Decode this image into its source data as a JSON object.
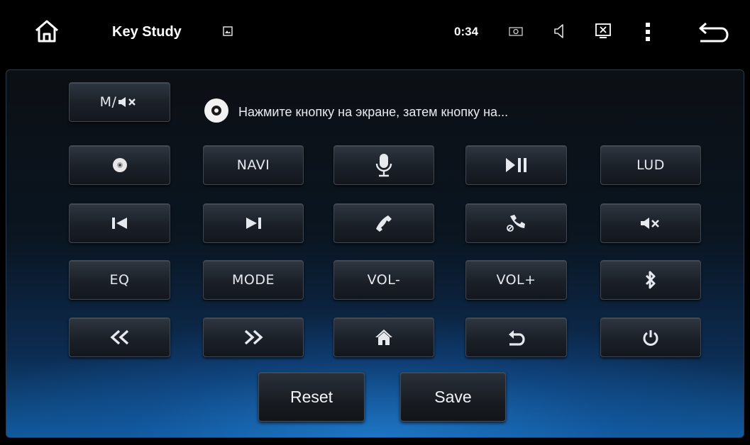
{
  "status_bar": {
    "title": "Key Study",
    "clock": "0:34",
    "icons": [
      "home-icon",
      "image-icon",
      "camera-icon",
      "volume-icon",
      "screen-close-icon",
      "more-vert-icon",
      "back-icon"
    ]
  },
  "hint": {
    "icon": "disc-icon",
    "text": "Нажмите кнопку на экране, затем кнопку на..."
  },
  "top_key": {
    "label": "M/",
    "icon": "mute-icon"
  },
  "keys": {
    "row1": [
      {
        "icon": "disc-icon"
      },
      {
        "label": "NAVI"
      },
      {
        "icon": "microphone-icon"
      },
      {
        "icon": "play-pause-icon"
      },
      {
        "label": "LUD"
      }
    ],
    "row2": [
      {
        "icon": "previous-track-icon"
      },
      {
        "icon": "next-track-icon"
      },
      {
        "icon": "phone-answer-icon"
      },
      {
        "icon": "phone-hangup-icon"
      },
      {
        "icon": "mute-icon"
      }
    ],
    "row3": [
      {
        "label": "EQ"
      },
      {
        "label": "MODE"
      },
      {
        "label": "VOL-"
      },
      {
        "label": "VOL+"
      },
      {
        "icon": "bluetooth-icon"
      }
    ],
    "row4": [
      {
        "icon": "rewind-icon"
      },
      {
        "icon": "fast-forward-icon"
      },
      {
        "icon": "home-icon"
      },
      {
        "icon": "back-icon"
      },
      {
        "icon": "power-icon"
      }
    ]
  },
  "actions": {
    "reset": "Reset",
    "save": "Save"
  },
  "colors": {
    "accent_blue": "#115a9c",
    "key_dark": "#1b2028",
    "text": "#e8ecf0"
  }
}
